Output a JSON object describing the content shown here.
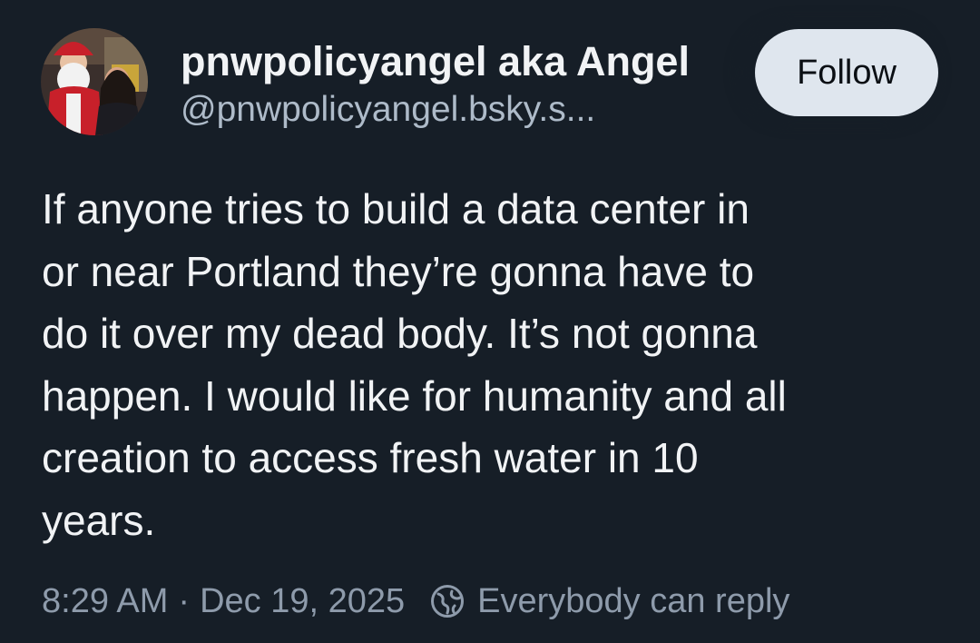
{
  "post": {
    "author": {
      "display_name": "pnwpolicyangel aka Angel",
      "handle": "@pnwpolicyangel.bsky.s..."
    },
    "follow_label": "Follow",
    "text": "If anyone tries to build a data center in\nor near Portland they’re gonna have to\ndo it over my dead body. It’s not gonna\nhappen. I would like for humanity and all\ncreation to access fresh water in 10\nyears.",
    "time": "8:29 AM",
    "separator": "·",
    "date": "Dec 19, 2025",
    "reply_setting": "Everybody can reply",
    "reply_icon": "globe-icon"
  },
  "colors": {
    "background": "#161e27",
    "text": "#f1f3f5",
    "handle": "#aebbc9",
    "meta": "#8e9bab",
    "follow_button_bg": "#dfe6ee"
  }
}
